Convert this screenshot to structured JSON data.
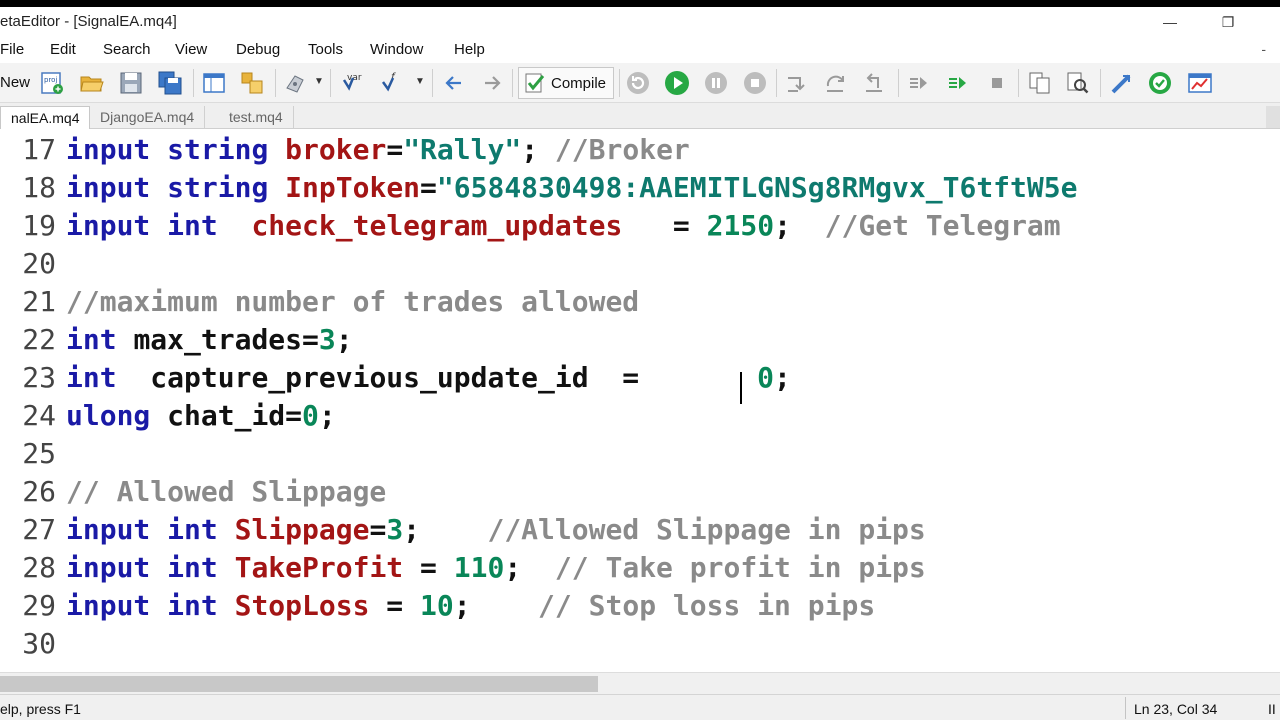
{
  "window": {
    "title": "etaEditor - [SignalEA.mq4]",
    "minimize_glyph": "—",
    "restore_glyph": "❐"
  },
  "menu": {
    "items": [
      "File",
      "Edit",
      "Search",
      "View",
      "Debug",
      "Tools",
      "Window",
      "Help"
    ],
    "doc_minimize": "-"
  },
  "toolbar": {
    "new_label": "New",
    "compile_label": "Compile"
  },
  "tabs": [
    "nalEA.mq4",
    "DjangoEA.mq4",
    "test.mq4"
  ],
  "editor": {
    "lines": [
      {
        "n": "17",
        "tokens": [
          [
            "kw",
            "input"
          ],
          [
            "op",
            " "
          ],
          [
            "kw",
            "string"
          ],
          [
            "op",
            " "
          ],
          [
            "ext",
            "broker"
          ],
          [
            "op",
            "="
          ],
          [
            "str",
            "\"Rally\""
          ],
          [
            "op",
            "; "
          ],
          [
            "cm",
            "//Broker"
          ]
        ]
      },
      {
        "n": "18",
        "tokens": [
          [
            "kw",
            "input"
          ],
          [
            "op",
            " "
          ],
          [
            "kw",
            "string"
          ],
          [
            "op",
            " "
          ],
          [
            "ext",
            "InpToken"
          ],
          [
            "op",
            "="
          ],
          [
            "str",
            "\"6584830498:AAEMITLGNSg8RMgvx_T6tftW5e"
          ]
        ]
      },
      {
        "n": "19",
        "tokens": [
          [
            "kw",
            "input"
          ],
          [
            "op",
            " "
          ],
          [
            "kw",
            "int"
          ],
          [
            "op",
            "  "
          ],
          [
            "ext",
            "check_telegram_updates"
          ],
          [
            "op",
            "   = "
          ],
          [
            "num",
            "2150"
          ],
          [
            "op",
            ";  "
          ],
          [
            "cm",
            "//Get Telegram"
          ]
        ]
      },
      {
        "n": "20",
        "tokens": []
      },
      {
        "n": "21",
        "tokens": [
          [
            "cm",
            "//maximum number of trades allowed"
          ]
        ]
      },
      {
        "n": "22",
        "tokens": [
          [
            "kw",
            "int"
          ],
          [
            "op",
            " "
          ],
          [
            "id",
            "max_trades"
          ],
          [
            "op",
            "="
          ],
          [
            "num",
            "3"
          ],
          [
            "op",
            ";"
          ]
        ]
      },
      {
        "n": "23",
        "tokens": [
          [
            "kw",
            "int"
          ],
          [
            "op",
            "  "
          ],
          [
            "id",
            "capture_previous_update_id"
          ],
          [
            "op",
            "  =       "
          ],
          [
            "num",
            "0"
          ],
          [
            "op",
            ";"
          ]
        ]
      },
      {
        "n": "24",
        "tokens": [
          [
            "kw",
            "ulong"
          ],
          [
            "op",
            " "
          ],
          [
            "id",
            "chat_id"
          ],
          [
            "op",
            "="
          ],
          [
            "num",
            "0"
          ],
          [
            "op",
            ";"
          ]
        ]
      },
      {
        "n": "25",
        "tokens": []
      },
      {
        "n": "26",
        "tokens": [
          [
            "cm",
            "// Allowed Slippage"
          ]
        ]
      },
      {
        "n": "27",
        "tokens": [
          [
            "kw",
            "input"
          ],
          [
            "op",
            " "
          ],
          [
            "kw",
            "int"
          ],
          [
            "op",
            " "
          ],
          [
            "ext",
            "Slippage"
          ],
          [
            "op",
            "="
          ],
          [
            "num",
            "3"
          ],
          [
            "op",
            ";    "
          ],
          [
            "cm",
            "//Allowed Slippage in pips"
          ]
        ]
      },
      {
        "n": "28",
        "tokens": [
          [
            "kw",
            "input"
          ],
          [
            "op",
            " "
          ],
          [
            "kw",
            "int"
          ],
          [
            "op",
            " "
          ],
          [
            "ext",
            "TakeProfit"
          ],
          [
            "op",
            " = "
          ],
          [
            "num",
            "110"
          ],
          [
            "op",
            ";  "
          ],
          [
            "cm",
            "// Take profit in pips"
          ]
        ]
      },
      {
        "n": "29",
        "tokens": [
          [
            "kw",
            "input"
          ],
          [
            "op",
            " "
          ],
          [
            "kw",
            "int"
          ],
          [
            "op",
            " "
          ],
          [
            "ext",
            "StopLoss"
          ],
          [
            "op",
            " = "
          ],
          [
            "num",
            "10"
          ],
          [
            "op",
            ";    "
          ],
          [
            "cm",
            "// Stop loss in pips"
          ]
        ]
      },
      {
        "n": "30",
        "tokens": []
      }
    ]
  },
  "status": {
    "left": "elp, press F1",
    "position": "Ln 23, Col 34",
    "right_edge": "II"
  },
  "colors": {
    "keyword": "#1a1aa6",
    "extern_var": "#a31515",
    "string": "#0e7a6e",
    "number": "#098658",
    "comment": "#8a8a8a"
  }
}
